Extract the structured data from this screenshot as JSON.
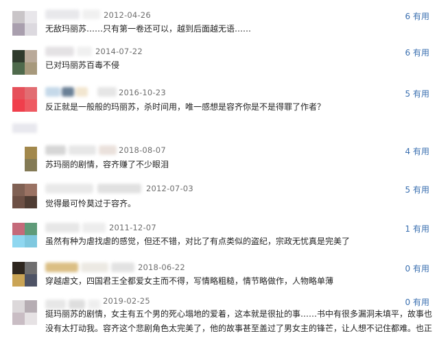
{
  "comments": [
    {
      "date": "2012-04-26",
      "useful": "6 有用",
      "text": "无敌玛丽苏……只有第一卷还可以，越到后面越无语……",
      "avatar": [
        "#c9c5c8",
        "#e8e6ea",
        "#a99fae",
        "#dcd9df"
      ],
      "name": [
        "#e4e4e8",
        "#eeeeee"
      ]
    },
    {
      "date": "2014-07-22",
      "useful": "6 有用",
      "text": "已对玛丽苏百毒不侵",
      "avatar": [
        "#2f3a2c",
        "#b9a999",
        "#4f6a4c",
        "#a7997c"
      ],
      "name": [
        "#e0dde0",
        "#eeeeee"
      ]
    },
    {
      "date": "2016-10-23",
      "useful": "5 有用",
      "text": "反正就是一般般的玛丽苏，杀时间用，唯一感想是容齐你是不是得罪了作者？",
      "avatar": [
        "#e6505a",
        "#e26d72",
        "#f03f4c",
        "#ee5a62"
      ],
      "name": [
        "#bcd3e6",
        "#516a84",
        "#f0e2c8",
        "#e2e2e2"
      ]
    },
    {
      "date": "2018-08-07",
      "useful": "4 有用",
      "text": "苏玛丽的剧情，容齐赚了不少眼泪",
      "avatar": [
        "#ffffff",
        "#a2884c",
        "#ffffff",
        "#837a55"
      ],
      "name": [
        "#cfcfcf",
        "#e3e3e3",
        "#e7dcd6"
      ]
    },
    {
      "date": "2012-07-03",
      "useful": "5 有用",
      "text": "觉得最可怜莫过于容齐。",
      "avatar": [
        "#806154",
        "#9a7263",
        "#6d5045",
        "#4f3c33"
      ],
      "name": [
        "#e6e6e6",
        "#dcdcdc"
      ]
    },
    {
      "date": "2011-12-07",
      "useful": "1 有用",
      "text": "虽然有种为虐找虐的感觉，但还不错，对比了有点类似的盗纪，宗政无忧真是完美了",
      "avatar": [
        "#c56a7a",
        "#5f9b79",
        "#8fd7f0",
        "#7fc8df"
      ],
      "name": [
        "#e3e3e3",
        "#eaeaea"
      ]
    },
    {
      "date": "2018-06-22",
      "useful": "0 有用",
      "text": "穿越虐文，四国君王全都爱女主而不得，写情略粗糙，情节略做作，人物略单薄",
      "avatar": [
        "#2e261f",
        "#6f6e6f",
        "#caa455",
        "#4e5365"
      ],
      "name": [
        "#d5b46f",
        "#e9e6df",
        "#dedede"
      ]
    },
    {
      "date": "2019-02-25",
      "useful": "0 有用",
      "text": "挺玛丽苏的剧情，女主有五个男的死心塌地的爱着，这本就是很扯的事……书中有很多漏洞未填平，故事也",
      "text2": "没有太打动我。容齐这个悲剧角色太完美了，他的故事甚至盖过了男女主的锋芒，让人想不记住都难。也正",
      "avatar": [
        "#dcd8da",
        "#b6adb3",
        "#c9bdc4",
        "#e6e2e4"
      ],
      "name": [
        "#e3e3e3",
        "#d9d9d9",
        "#ececec"
      ]
    }
  ]
}
